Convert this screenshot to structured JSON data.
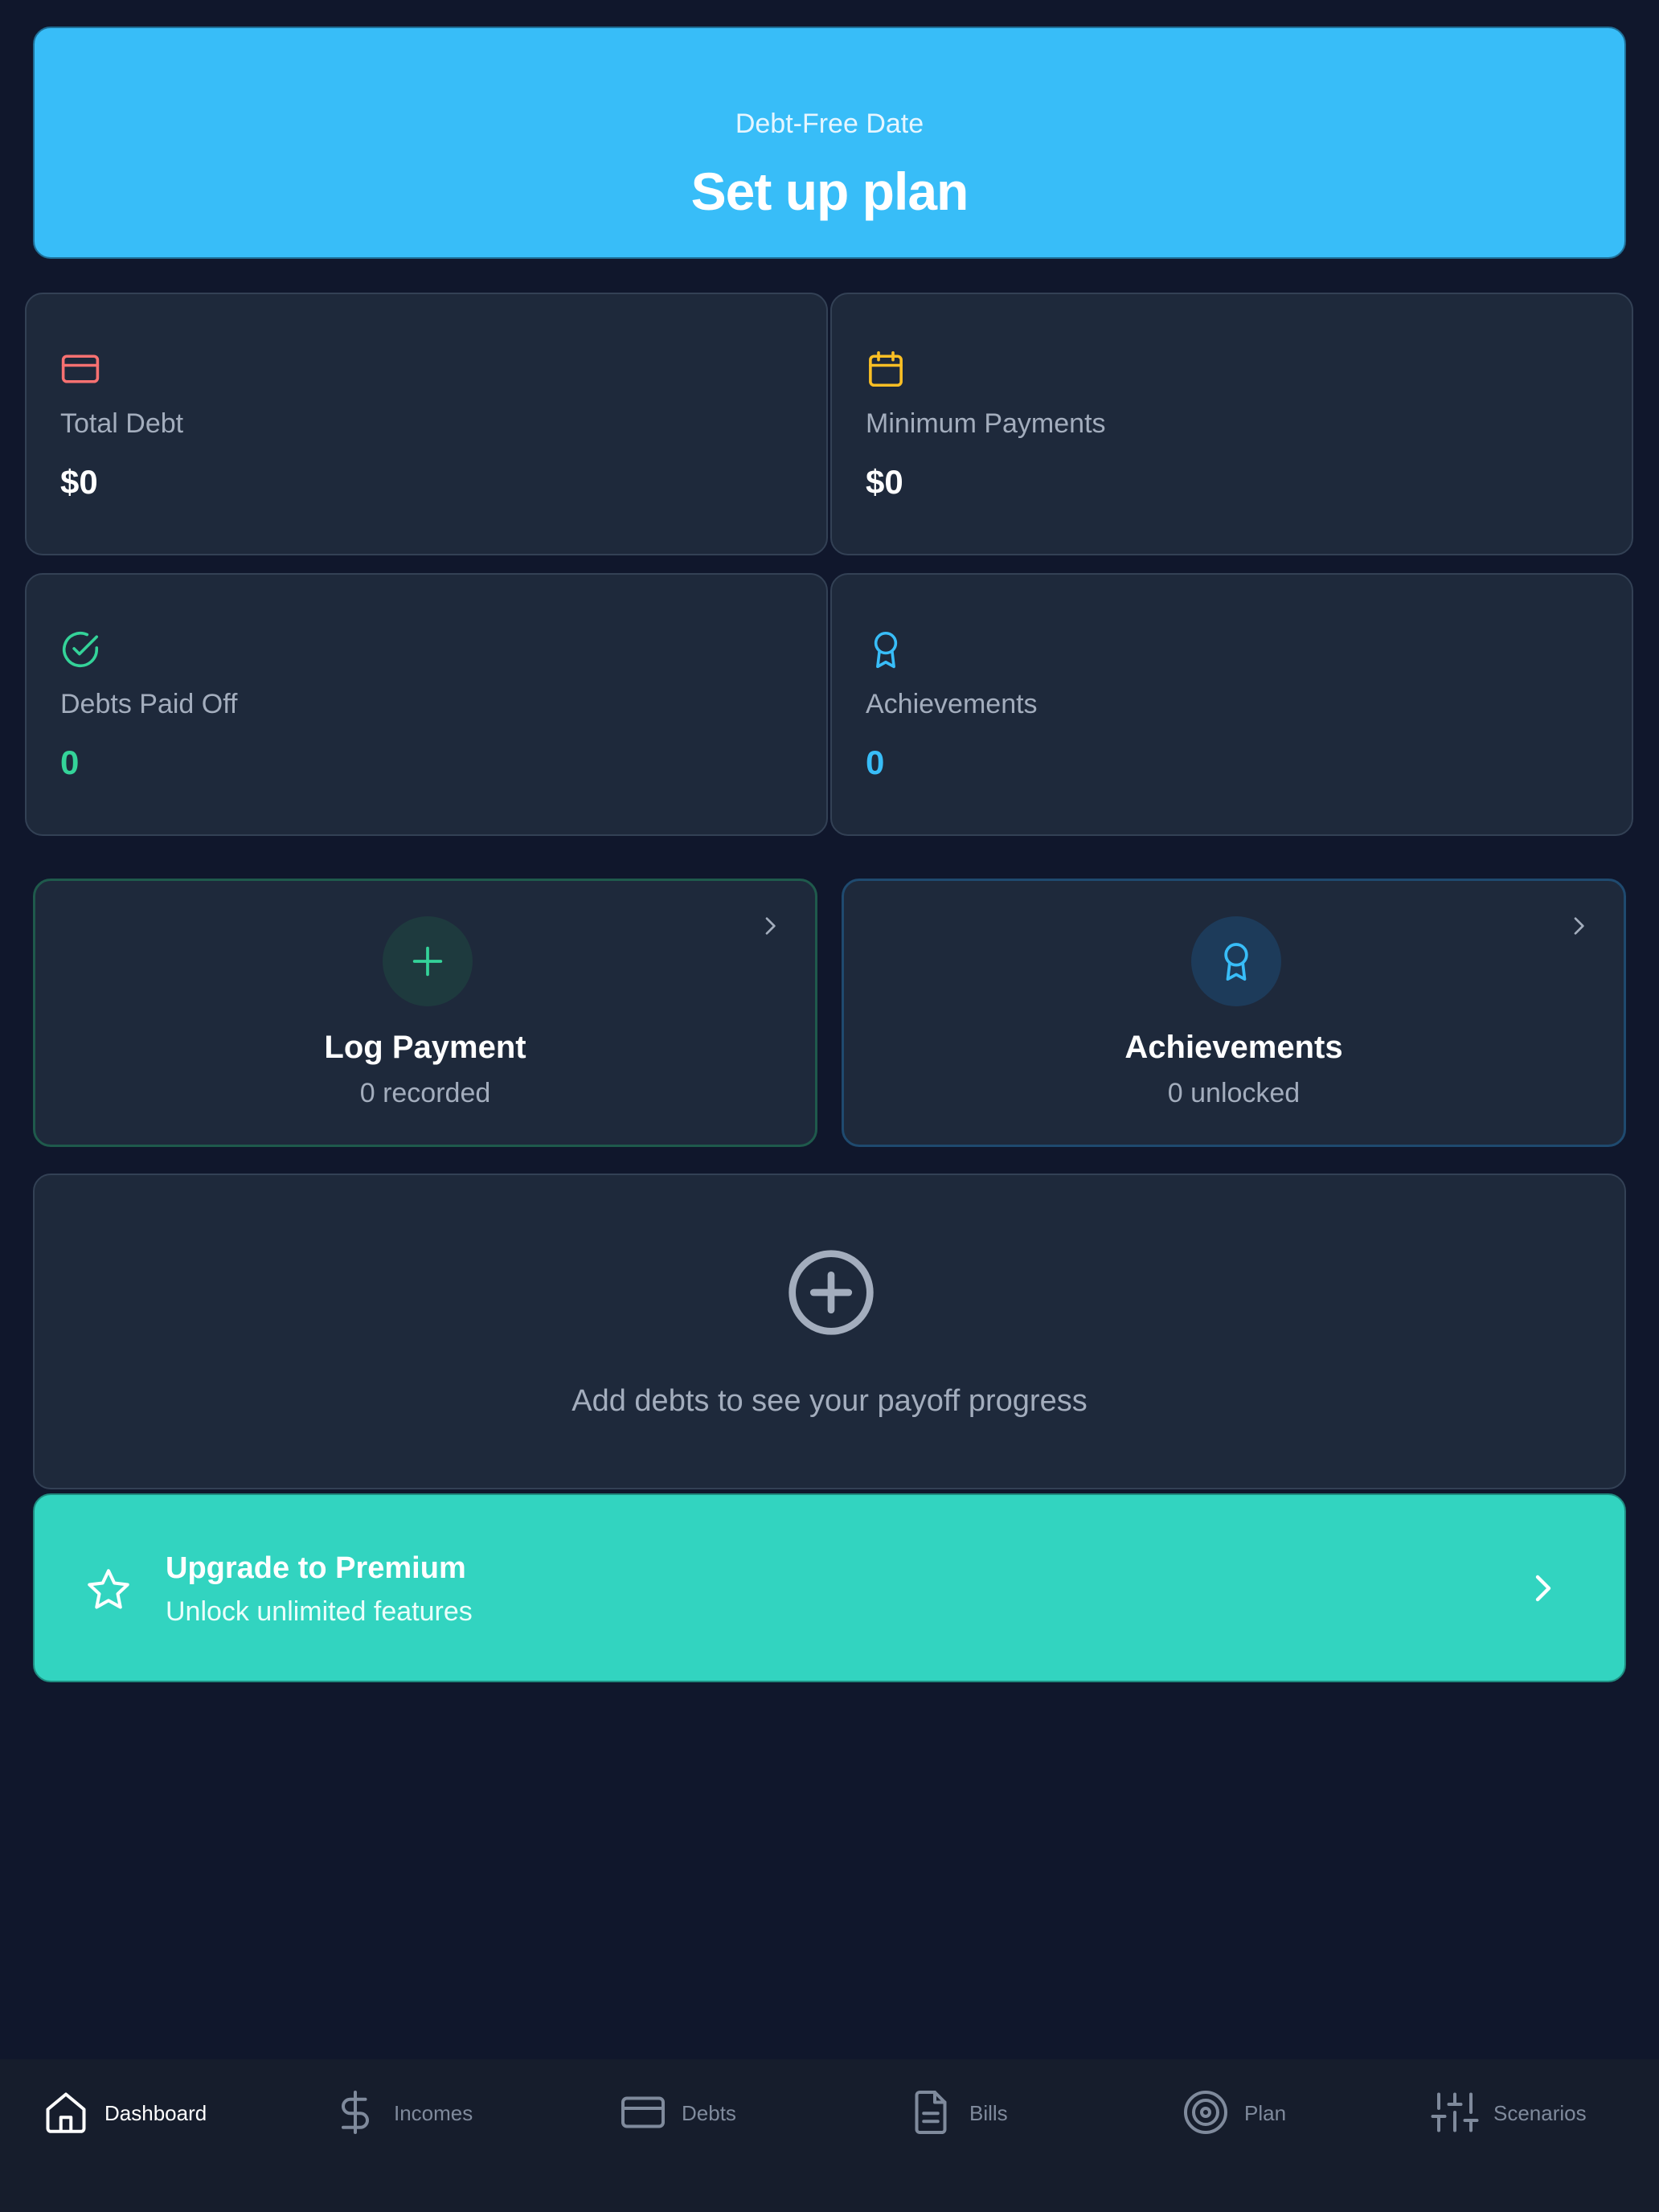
{
  "hero": {
    "label": "Debt-Free Date",
    "title": "Set up plan",
    "color": "#38bdf8"
  },
  "stats": [
    {
      "icon": "credit-card-icon",
      "label": "Total Debt",
      "value": "$0",
      "icon_color": "#f87171"
    },
    {
      "icon": "calendar-icon",
      "label": "Minimum Payments",
      "value": "$0",
      "icon_color": "#fbbf24"
    },
    {
      "icon": "check-circle-icon",
      "label": "Debts Paid Off",
      "value": "0",
      "icon_color": "#34d399"
    },
    {
      "icon": "award-icon",
      "label": "Achievements",
      "value": "0",
      "icon_color": "#38bdf8"
    }
  ],
  "actions": [
    {
      "icon": "plus-icon",
      "title": "Log Payment",
      "subtitle": "0 recorded"
    },
    {
      "icon": "award-icon",
      "title": "Achievements",
      "subtitle": "0 unlocked"
    }
  ],
  "empty_state": {
    "icon": "plus-circle-icon",
    "message": "Add debts to see your payoff progress"
  },
  "premium": {
    "icon": "star-icon",
    "title": "Upgrade to Premium",
    "subtitle": "Unlock unlimited features",
    "color": "#32d4c0"
  },
  "nav": {
    "items": [
      {
        "icon": "home-icon",
        "label": "Dashboard",
        "active": true
      },
      {
        "icon": "dollar-icon",
        "label": "Incomes",
        "active": false
      },
      {
        "icon": "credit-card-icon",
        "label": "Debts",
        "active": false
      },
      {
        "icon": "file-text-icon",
        "label": "Bills",
        "active": false
      },
      {
        "icon": "target-icon",
        "label": "Plan",
        "active": false
      },
      {
        "icon": "sliders-icon",
        "label": "Scenarios",
        "active": false
      }
    ]
  }
}
